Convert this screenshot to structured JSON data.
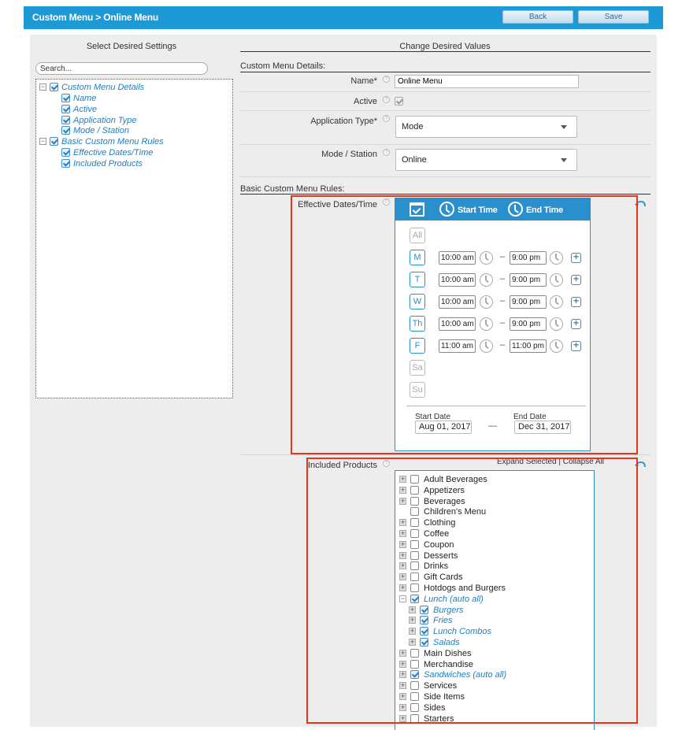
{
  "header": {
    "title": "Custom Menu > Online Menu",
    "back_label": "Back",
    "save_label": "Save"
  },
  "left_panel": {
    "title": "Select Desired Settings",
    "search_placeholder": "Search...",
    "tree": [
      {
        "label": "Custom Menu Details",
        "expander": "−",
        "checked": true,
        "level": 0
      },
      {
        "label": "Name",
        "checked": true,
        "level": 1
      },
      {
        "label": "Active",
        "checked": true,
        "level": 1
      },
      {
        "label": "Application Type",
        "checked": true,
        "level": 1
      },
      {
        "label": "Mode / Station",
        "checked": true,
        "level": 1
      },
      {
        "label": "Basic Custom Menu Rules",
        "expander": "−",
        "checked": true,
        "level": 0
      },
      {
        "label": "Effective Dates/Time",
        "checked": true,
        "level": 1
      },
      {
        "label": "Included Products",
        "checked": true,
        "level": 1
      }
    ]
  },
  "right_panel": {
    "title": "Change Desired Values",
    "details_section": "Custom Menu Details:",
    "rules_section": "Basic Custom Menu Rules:",
    "name": {
      "label": "Name*",
      "value": "Online Menu"
    },
    "active": {
      "label": "Active",
      "checked": true
    },
    "app_type": {
      "label": "Application Type*",
      "value": "Mode"
    },
    "mode_station": {
      "label": "Mode / Station",
      "value": "Online"
    },
    "help_glyph": "?",
    "effective": {
      "label": "Effective Dates/Time",
      "start_time_header": "Start Time",
      "end_time_header": "End Time",
      "all_label": "All",
      "dash": "–",
      "plus": "+",
      "days": [
        {
          "label": "M",
          "active": true,
          "start": "10:00 am",
          "end": "9:00 pm"
        },
        {
          "label": "T",
          "active": true,
          "start": "10:00 am",
          "end": "9:00 pm"
        },
        {
          "label": "W",
          "active": true,
          "start": "10:00 am",
          "end": "9:00 pm"
        },
        {
          "label": "Th",
          "active": true,
          "start": "10:00 am",
          "end": "9:00 pm"
        },
        {
          "label": "F",
          "active": true,
          "start": "11:00 am",
          "end": "11:00 pm"
        },
        {
          "label": "Sa",
          "active": false
        },
        {
          "label": "Su",
          "active": false
        }
      ],
      "start_date_label": "Start Date",
      "start_date": "Aug 01, 2017",
      "end_date_label": "End Date",
      "end_date": "Dec 31, 2017",
      "date_dash": "—"
    },
    "products": {
      "label": "Included Products",
      "expand_selected": "Expand Selected",
      "link_separator": " | ",
      "collapse_all": "Collapse All",
      "items": [
        {
          "label": "Adult Beverages",
          "level": 0,
          "expander": "+",
          "checked": false
        },
        {
          "label": "Appetizers",
          "level": 0,
          "expander": "+",
          "checked": false
        },
        {
          "label": "Beverages",
          "level": 0,
          "expander": "+",
          "checked": false
        },
        {
          "label": "Children's Menu",
          "level": 0,
          "expander": "",
          "checked": false
        },
        {
          "label": "Clothing",
          "level": 0,
          "expander": "+",
          "checked": false
        },
        {
          "label": "Coffee",
          "level": 0,
          "expander": "+",
          "checked": false
        },
        {
          "label": "Coupon",
          "level": 0,
          "expander": "+",
          "checked": false
        },
        {
          "label": "Desserts",
          "level": 0,
          "expander": "+",
          "checked": false
        },
        {
          "label": "Drinks",
          "level": 0,
          "expander": "+",
          "checked": false
        },
        {
          "label": "Gift Cards",
          "level": 0,
          "expander": "+",
          "checked": false
        },
        {
          "label": "Hotdogs and Burgers",
          "level": 0,
          "expander": "+",
          "checked": false
        },
        {
          "label": "Lunch (auto all)",
          "level": 0,
          "expander": "−",
          "checked": true
        },
        {
          "label": "Burgers",
          "level": 1,
          "expander": "+",
          "checked": true
        },
        {
          "label": "Fries",
          "level": 1,
          "expander": "+",
          "checked": true
        },
        {
          "label": "Lunch Combos",
          "level": 1,
          "expander": "+",
          "checked": true
        },
        {
          "label": "Salads",
          "level": 1,
          "expander": "+",
          "checked": true
        },
        {
          "label": "Main Dishes",
          "level": 0,
          "expander": "+",
          "checked": false
        },
        {
          "label": "Merchandise",
          "level": 0,
          "expander": "+",
          "checked": false
        },
        {
          "label": "Sandwiches (auto all)",
          "level": 0,
          "expander": "+",
          "checked": true
        },
        {
          "label": "Services",
          "level": 0,
          "expander": "+",
          "checked": false
        },
        {
          "label": "Side Items",
          "level": 0,
          "expander": "+",
          "checked": false
        },
        {
          "label": "Sides",
          "level": 0,
          "expander": "+",
          "checked": false
        },
        {
          "label": "Starters",
          "level": 0,
          "expander": "+",
          "checked": false
        }
      ]
    }
  },
  "colors": {
    "header_blue": "#1d9ad6",
    "accent_blue": "#2a8fcd",
    "highlight_red": "#e8331f",
    "panel_gray": "#ededed"
  }
}
